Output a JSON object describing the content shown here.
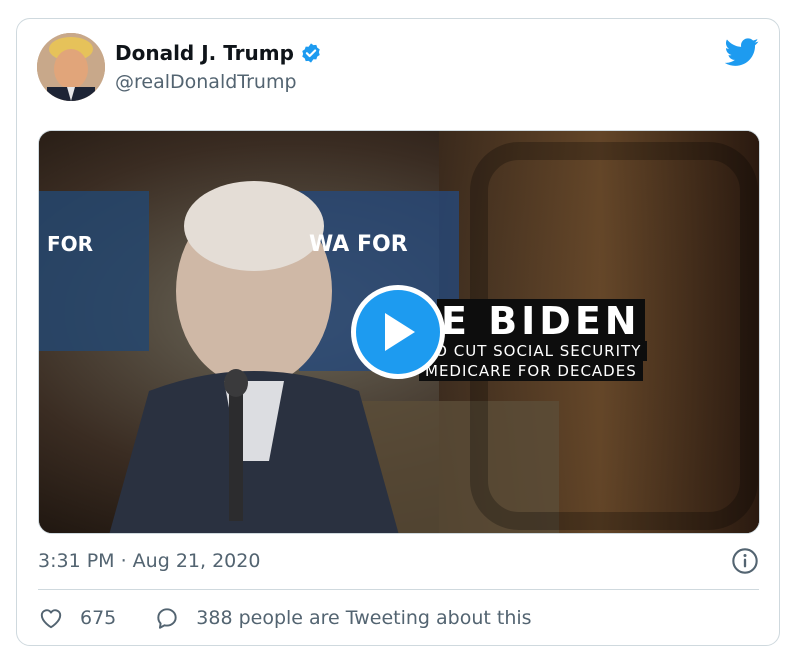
{
  "tweet": {
    "author_name": "Donald J. Trump",
    "handle": "@realDonaldTrump",
    "timestamp": "3:31 PM · Aug 21, 2020",
    "likes": "675",
    "retweet_text": "388 people are Tweeting about this"
  },
  "media": {
    "overlay_title": "E BIDEN",
    "overlay_line1": "TO CUT SOCIAL SECURITY",
    "overlay_line2": "MEDICARE FOR DECADES",
    "sign_text_1": "WA FOR",
    "sign_text_2": "FOR"
  },
  "icons": {
    "verified": "verified-badge-icon",
    "brand": "twitter-bird-icon",
    "play": "play-icon",
    "info": "info-icon",
    "like": "heart-icon",
    "reply": "speech-bubble-icon"
  },
  "colors": {
    "accent": "#1d9bf0",
    "text_primary": "#0f1419",
    "text_secondary": "#536471",
    "border": "#cfd9de"
  }
}
